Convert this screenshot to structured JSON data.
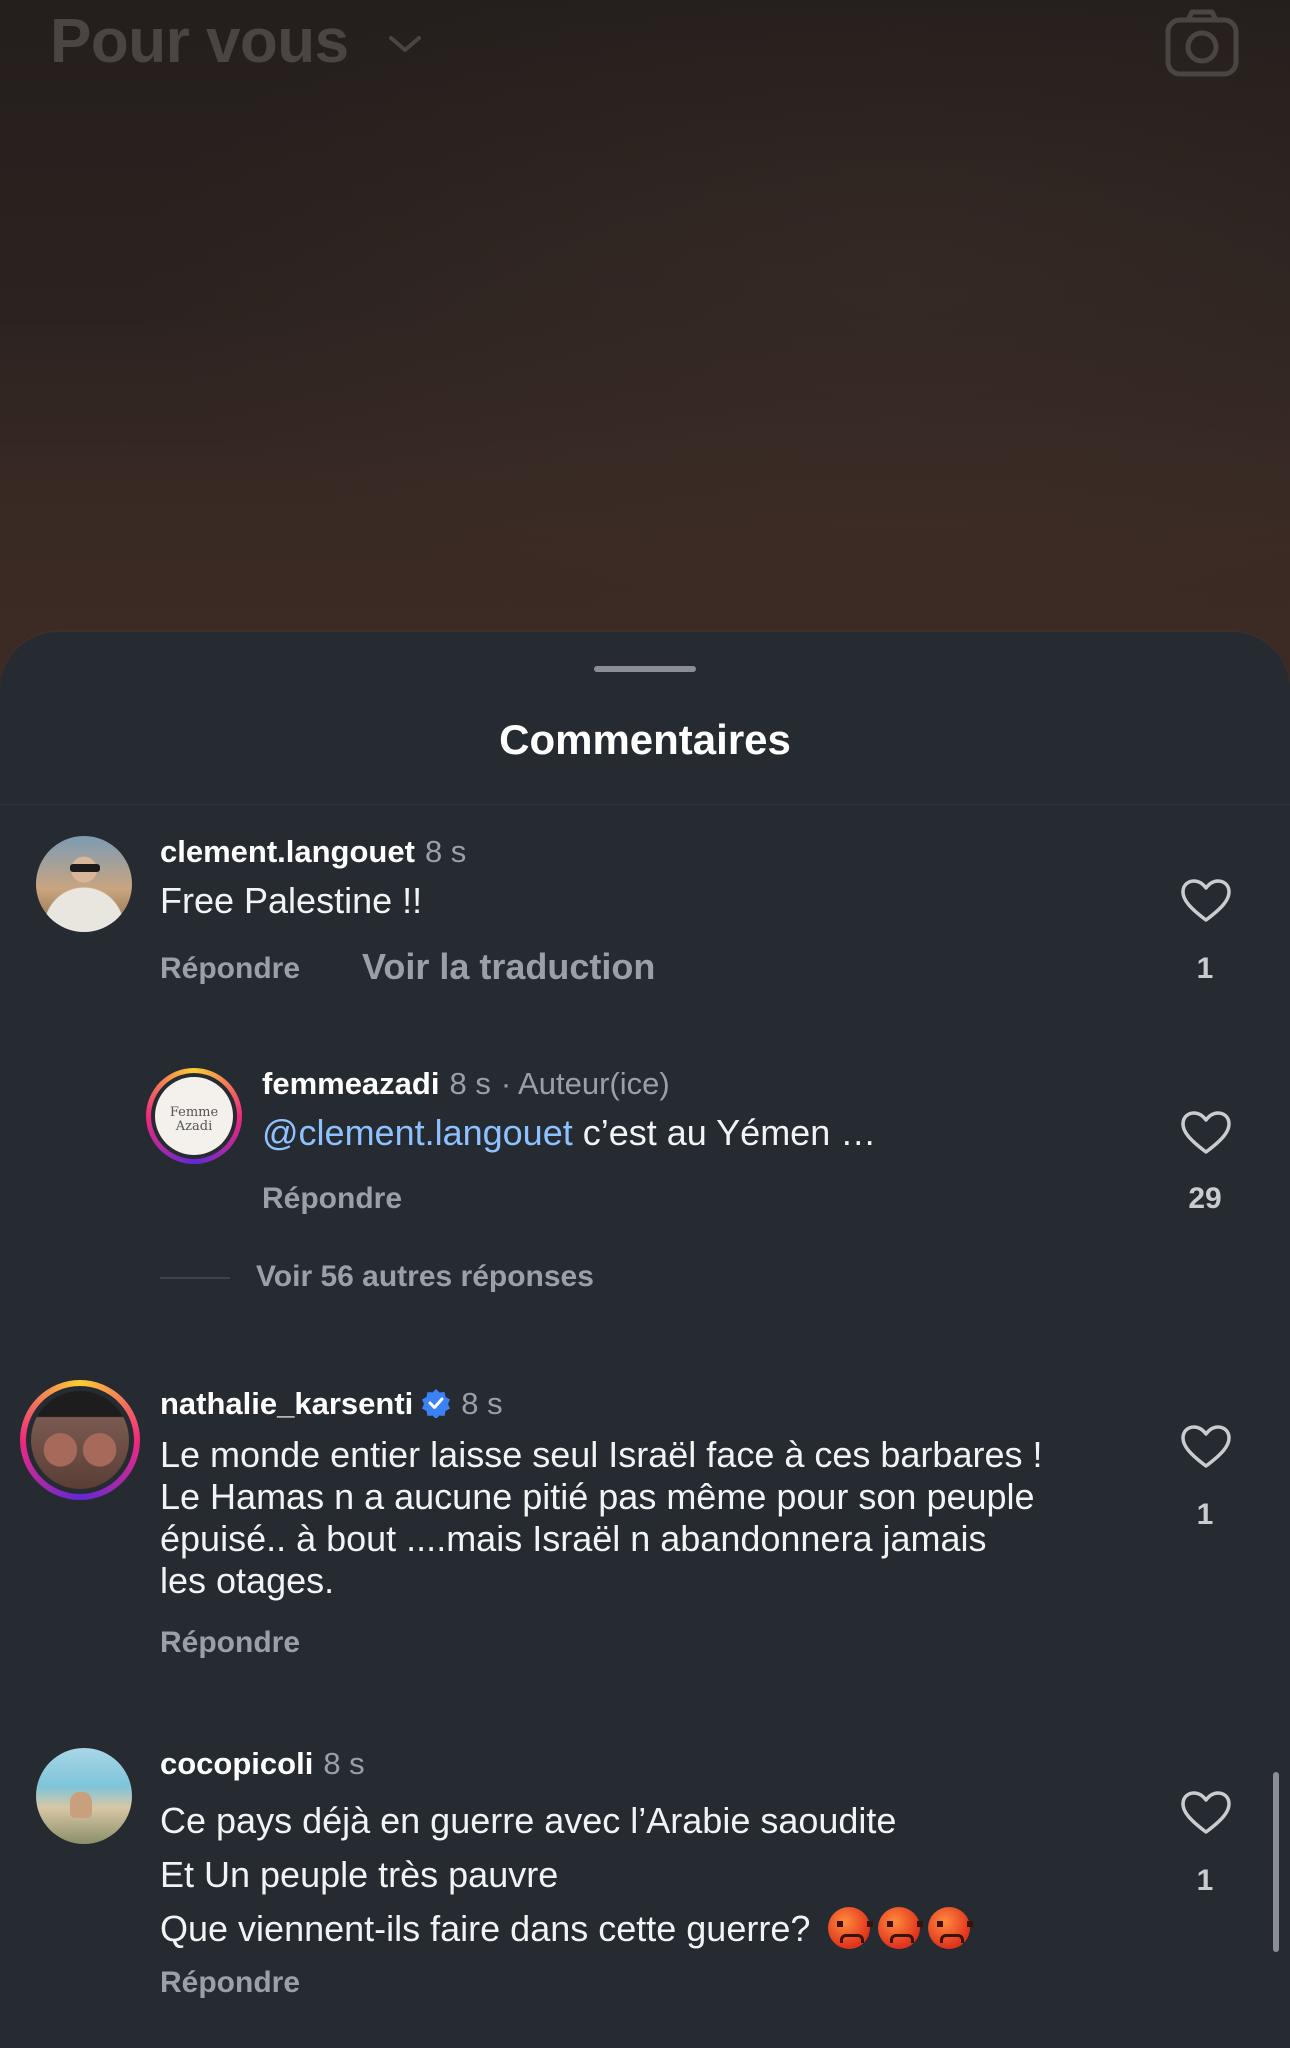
{
  "header": {
    "feed_title": "Pour vous",
    "camera_icon": "camera-icon",
    "chevron_icon": "chevron-down-icon"
  },
  "sheet": {
    "title": "Commentaires"
  },
  "comments": [
    {
      "username": "clement.langouet",
      "time": "8 s",
      "text": "Free Palestine !!",
      "reply_label": "Répondre",
      "translate_label": "Voir la traduction",
      "likes": "1"
    },
    {
      "username": "femmeazadi",
      "time": "8 s",
      "author_tag": "· Auteur(ice)",
      "mention": "@clement.langouet",
      "text": " c’est au Yémen …",
      "reply_label": "Répondre",
      "likes": "29",
      "avatar_text_1": "Femme",
      "avatar_text_2": "Azadi"
    },
    {
      "username": "nathalie_karsenti",
      "time": "8 s",
      "verified_icon": "verified-badge-icon",
      "lines": [
        "Le monde entier laisse seul Israël face à ces barbares !",
        "Le Hamas n a aucune pitié pas même pour son peuple",
        "épuisé.. à bout ....mais Israël n abandonnera jamais",
        "les otages."
      ],
      "reply_label": "Répondre",
      "likes": "1"
    },
    {
      "username": "cocopicoli",
      "time": "8 s",
      "lines": [
        "Ce pays déjà en guerre avec l’Arabie saoudite",
        "Et Un peuple très pauvre",
        "Que viennent-ils faire dans cette guerre?"
      ],
      "emoji_icon": "angry-face-emoji",
      "reply_label": "Répondre",
      "likes": "1"
    }
  ],
  "more_replies": "Voir 56 autres réponses",
  "colors": {
    "sheet_bg": "#262b32",
    "mention": "#8ec1ff",
    "muted": "#9aa0a8",
    "verified": "#3b82f6"
  }
}
